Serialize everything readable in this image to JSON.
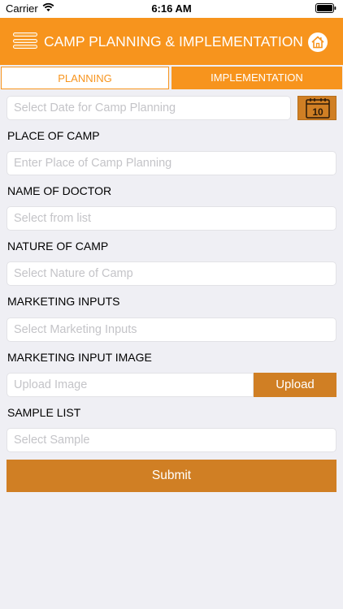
{
  "status_bar": {
    "carrier": "Carrier",
    "time": "6:16 AM"
  },
  "header": {
    "title": "CAMP PLANNING & IMPLEMENTATION"
  },
  "tabs": [
    {
      "label": "PLANNING",
      "active": true
    },
    {
      "label": "IMPLEMENTATION",
      "active": false
    }
  ],
  "form": {
    "date_placeholder": "Select Date for Camp Planning",
    "calendar_day": "10",
    "place_label": "PLACE OF CAMP",
    "place_placeholder": "Enter Place of Camp Planning",
    "doctor_label": "NAME OF DOCTOR",
    "doctor_placeholder": "Select from list",
    "nature_label": "NATURE OF CAMP",
    "nature_placeholder": "Select Nature of Camp",
    "marketing_label": "MARKETING INPUTS",
    "marketing_placeholder": "Select Marketing Inputs",
    "image_label": "MARKETING INPUT IMAGE",
    "image_placeholder": "Upload Image",
    "upload_label": "Upload",
    "sample_label": "SAMPLE LIST",
    "sample_placeholder": "Select Sample",
    "submit_label": "Submit"
  },
  "colors": {
    "header": "#f7941d",
    "button": "#d07f24",
    "background": "#efeff4"
  },
  "icons": [
    "wifi-icon",
    "battery-icon",
    "menu-icon",
    "home-icon",
    "calendar-icon"
  ]
}
